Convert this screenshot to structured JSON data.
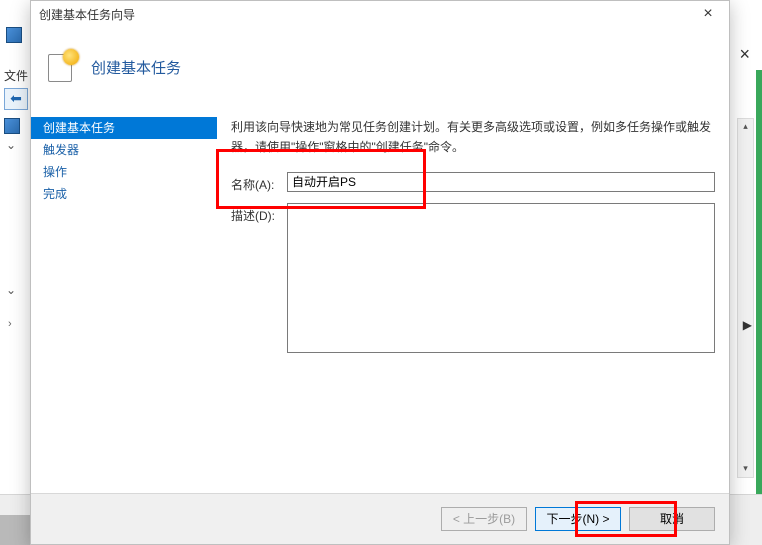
{
  "window": {
    "title": "创建基本任务向导"
  },
  "header": {
    "title": "创建基本任务"
  },
  "sidebar": {
    "steps": [
      {
        "label": "创建基本任务",
        "active": true
      },
      {
        "label": "触发器",
        "active": false
      },
      {
        "label": "操作",
        "active": false
      },
      {
        "label": "完成",
        "active": false
      }
    ]
  },
  "intro": {
    "text": "利用该向导快速地为常见任务创建计划。有关更多高级选项或设置，例如多任务操作或触发器，请使用\"操作\"窗格中的\"创建任务\"命令。"
  },
  "form": {
    "name_label": "名称(A):",
    "name_value": "自动开启PS",
    "desc_label": "描述(D):",
    "desc_value": ""
  },
  "footer": {
    "back": "< 上一步(B)",
    "next": "下一步(N) >",
    "cancel": "取消"
  },
  "background": {
    "file_menu": "文件"
  }
}
